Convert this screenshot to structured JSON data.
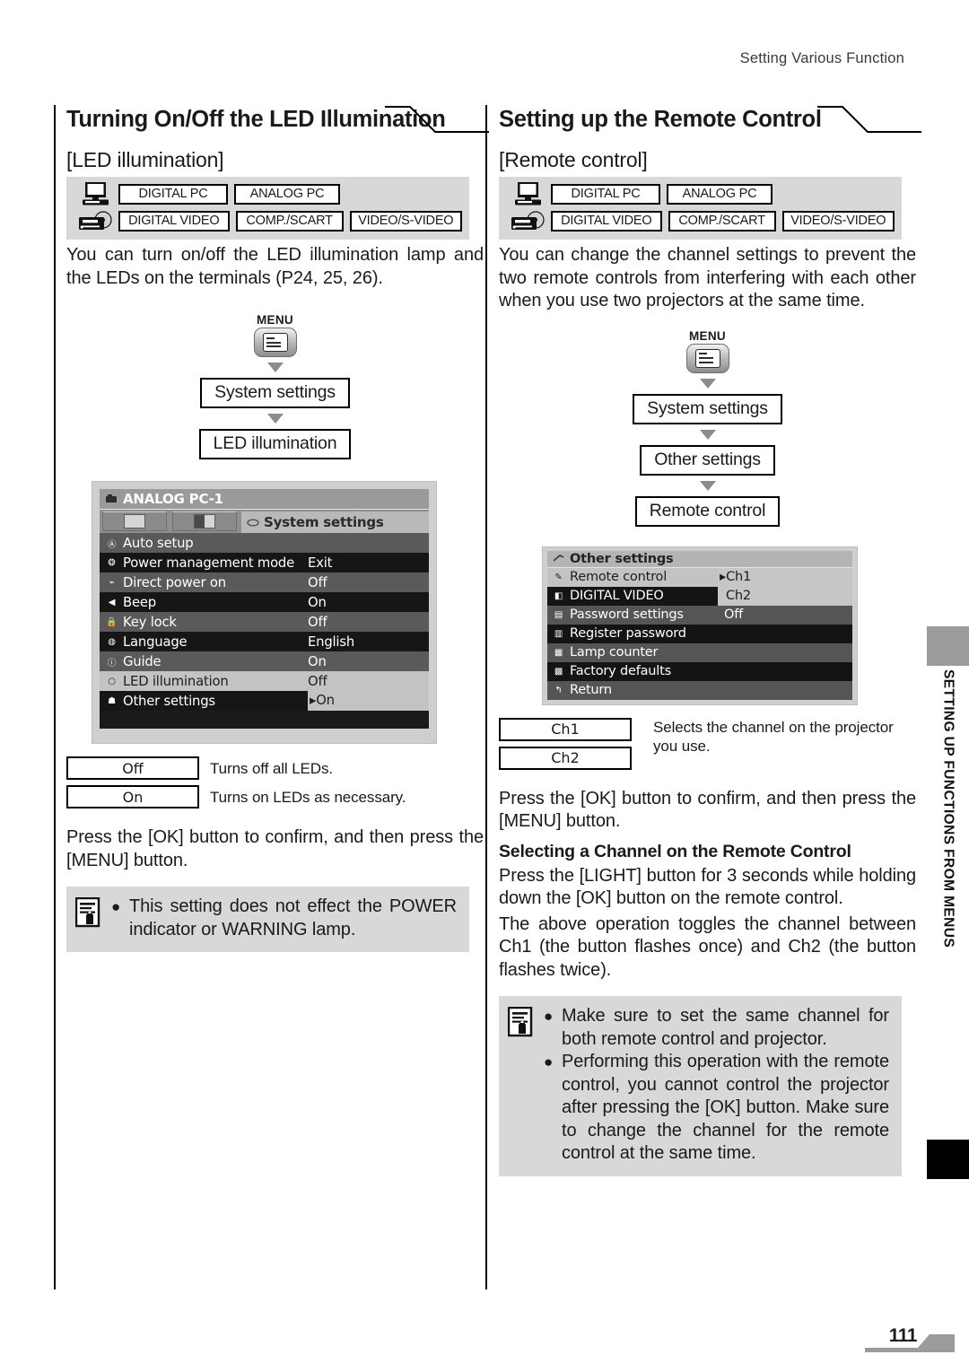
{
  "page": {
    "running_head": "Setting Various Function",
    "folio": "111",
    "side_tab": "SETTING UP FUNCTIONS FROM MENUS"
  },
  "compat": {
    "pc_icon": "computer-icon",
    "video_icon": "video-player-icon",
    "chips": [
      "DIGITAL PC",
      "ANALOG PC",
      "DIGITAL VIDEO",
      "COMP./SCART",
      "VIDEO/S-VIDEO"
    ]
  },
  "left": {
    "heading": "Turning On/Off the LED Illumination",
    "subheading": "[LED illumination]",
    "intro": "You can turn on/off the LED illumination lamp and the LEDs on the terminals (P24, 25, 26).",
    "flow": {
      "menu_label": "MENU",
      "steps": [
        "System settings",
        "LED illumination"
      ]
    },
    "osd": {
      "title": "ANALOG PC-1",
      "active_tab": "System settings",
      "rows": [
        {
          "label": "Auto setup",
          "value": "",
          "icon": "auto-icon"
        },
        {
          "label": "Power management mode",
          "value": "Exit",
          "icon": "power-icon"
        },
        {
          "label": "Direct power on",
          "value": "Off",
          "icon": "plug-icon"
        },
        {
          "label": "Beep",
          "value": "On",
          "icon": "speaker-icon"
        },
        {
          "label": "Key lock",
          "value": "Off",
          "icon": "lock-icon"
        },
        {
          "label": "Language",
          "value": "English",
          "icon": "language-icon"
        },
        {
          "label": "Guide",
          "value": "On",
          "icon": "info-icon"
        },
        {
          "label": "LED illumination",
          "value": "Off",
          "icon": "led-icon"
        },
        {
          "label": "Other settings",
          "value": "On",
          "icon": "settings-icon"
        }
      ]
    },
    "options": [
      {
        "key": "Off",
        "desc": "Turns off all LEDs."
      },
      {
        "key": "On",
        "desc": "Turns on LEDs as necessary."
      }
    ],
    "confirm": "Press the [OK] button to confirm, and then press the [MENU] button.",
    "note": {
      "icon": "memo-note-icon",
      "items": [
        "This setting does not effect the POWER indicator or WARNING lamp."
      ]
    }
  },
  "right": {
    "heading": "Setting up the Remote Control",
    "subheading": "[Remote control]",
    "intro": "You can change the channel settings to prevent the two remote controls from interfering with each other when you use two projectors at the same time.",
    "flow": {
      "menu_label": "MENU",
      "steps": [
        "System settings",
        "Other settings",
        "Remote control"
      ]
    },
    "osd": {
      "title": "Other settings",
      "rows": [
        {
          "label": "Remote control",
          "value": "Ch1",
          "icon": "remote-icon"
        },
        {
          "label": "DIGITAL VIDEO",
          "value": "Ch2",
          "icon": "video-icon"
        },
        {
          "label": "Password settings",
          "value": "Off",
          "icon": "password-icon"
        },
        {
          "label": "Register password",
          "value": "",
          "icon": "register-icon"
        },
        {
          "label": "Lamp counter",
          "value": "",
          "icon": "lamp-icon"
        },
        {
          "label": "Factory defaults",
          "value": "",
          "icon": "factory-icon"
        },
        {
          "label": "Return",
          "value": "",
          "icon": "return-icon"
        }
      ]
    },
    "options": [
      {
        "key": "Ch1",
        "desc": "Selects the channel on the projector you use."
      },
      {
        "key": "Ch2",
        "desc": ""
      }
    ],
    "confirm": "Press the [OK] button to confirm, and then press the [MENU] button.",
    "subhead2": "Selecting a Channel on the Remote Control",
    "para2": "Press the [LIGHT] button for 3 seconds while holding down the [OK] button on the remote control.",
    "para3": "The above operation toggles the channel between Ch1 (the button flashes once) and Ch2 (the button flashes twice).",
    "note": {
      "icon": "memo-note-icon",
      "items": [
        "Make sure to set the same channel for both remote control and projector.",
        "Performing this operation with the remote control, you cannot control the projector after pressing the [OK] button. Make sure to change the channel for the remote control at the same time."
      ]
    }
  }
}
